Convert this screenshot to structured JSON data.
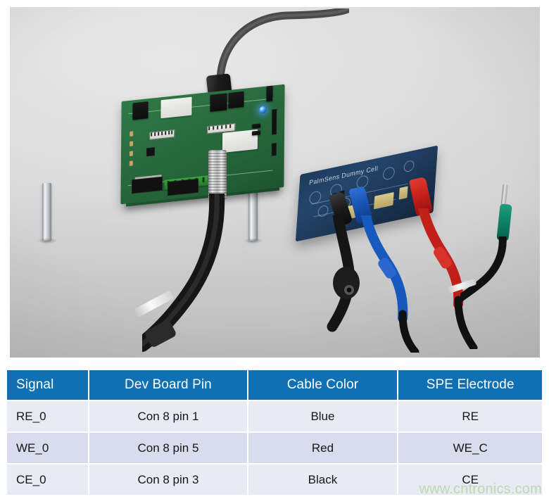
{
  "photo": {
    "alt": "Photograph of a PalmSens EmStat development board on aluminium standoffs connected via a LEMO cable to a PalmSens Dummy Cell board using black, blue and red alligator clips and a green banana plug",
    "devboard_name": "dev-board",
    "dummy_cell_label": "PalmSens Dummy Cell",
    "clips": [
      {
        "name": "black-alligator-clip",
        "color": "#1a1a1a",
        "label": "Black"
      },
      {
        "name": "blue-alligator-clip",
        "color": "#1853b4",
        "label": "Blue"
      },
      {
        "name": "red-alligator-clip",
        "color": "#c4201a",
        "label": "Red"
      },
      {
        "name": "green-banana-plug",
        "color": "#0f8266",
        "label": "Green"
      }
    ]
  },
  "table": {
    "header_bg": "#1070b4",
    "header_text_color": "#ffffff",
    "row_odd_bg": "#e8eaf4",
    "row_even_bg": "#d8dcec",
    "columns": [
      "Signal",
      "Dev Board Pin",
      "Cable Color",
      "SPE Electrode"
    ],
    "rows": [
      {
        "signal": "RE_0",
        "pin": "Con 8 pin 1",
        "cable": "Blue",
        "electrode": "RE"
      },
      {
        "signal": "WE_0",
        "pin": "Con 8 pin 5",
        "cable": "Red",
        "electrode": "WE_C"
      },
      {
        "signal": "CE_0",
        "pin": "Con 8 pin 3",
        "cable": "Black",
        "electrode": "CE"
      }
    ]
  },
  "watermark": {
    "text": "www.cntronics.com",
    "color": "#b9d9a8"
  }
}
